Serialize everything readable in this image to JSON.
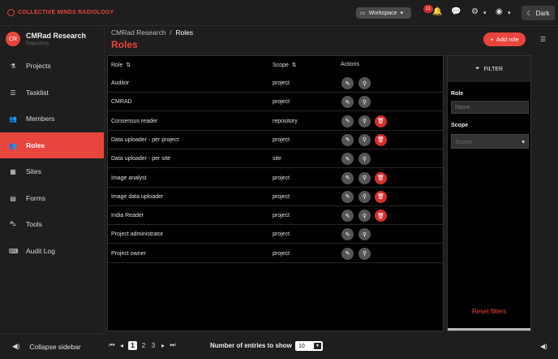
{
  "brand": {
    "name": "COLLECTIVE MINDS RADIOLOGY"
  },
  "topbar": {
    "workspace_label": "Workspace",
    "notification_count": "11",
    "theme_label": "Dark"
  },
  "sidebar": {
    "org_initials": "CR",
    "org_name": "CMRad Research",
    "org_type": "Repository",
    "items": [
      {
        "label": "Projects",
        "icon": "flask-icon"
      },
      {
        "label": "Tasklist",
        "icon": "list-icon"
      },
      {
        "label": "Members",
        "icon": "users-icon"
      },
      {
        "label": "Roles",
        "icon": "user-group-icon",
        "active": true
      },
      {
        "label": "Sites",
        "icon": "building-icon"
      },
      {
        "label": "Forms",
        "icon": "form-icon"
      },
      {
        "label": "Tools",
        "icon": "car-icon"
      },
      {
        "label": "Audit Log",
        "icon": "keyboard-icon"
      }
    ],
    "collapse_label": "Collapse sidebar"
  },
  "header": {
    "breadcrumb_parent": "CMRad Research",
    "breadcrumb_separator": "/",
    "breadcrumb_current": "Roles",
    "title": "Roles",
    "add_button_label": "Add role"
  },
  "table": {
    "columns": [
      "Role",
      "Scope",
      "Actions"
    ],
    "rows": [
      {
        "role": "Auditor",
        "scope": "project",
        "deletable": false
      },
      {
        "role": "CMRAD",
        "scope": "project",
        "deletable": false
      },
      {
        "role": "Consensus reader",
        "scope": "repository",
        "deletable": true
      },
      {
        "role": "Data uploader - per project",
        "scope": "project",
        "deletable": true
      },
      {
        "role": "Data uploader - per site",
        "scope": "site",
        "deletable": false
      },
      {
        "role": "Image analyst",
        "scope": "project",
        "deletable": true
      },
      {
        "role": "Image data uploader",
        "scope": "project",
        "deletable": true
      },
      {
        "role": "India Reader",
        "scope": "project",
        "deletable": true
      },
      {
        "role": "Project administrator",
        "scope": "project",
        "deletable": false
      },
      {
        "role": "Project owner",
        "scope": "project",
        "deletable": false
      }
    ]
  },
  "filter": {
    "title": "FILTER",
    "role_label": "Role",
    "role_placeholder": "Name",
    "scope_label": "Scope",
    "scope_placeholder": "Scope",
    "reset_label": "Reset filters"
  },
  "pagination": {
    "pages": [
      "1",
      "2",
      "3"
    ],
    "current_page": "1",
    "entries_label": "Number of entries to show",
    "entries_value": "10"
  },
  "colors": {
    "accent": "#e8453c",
    "danger": "#d32f2f"
  }
}
